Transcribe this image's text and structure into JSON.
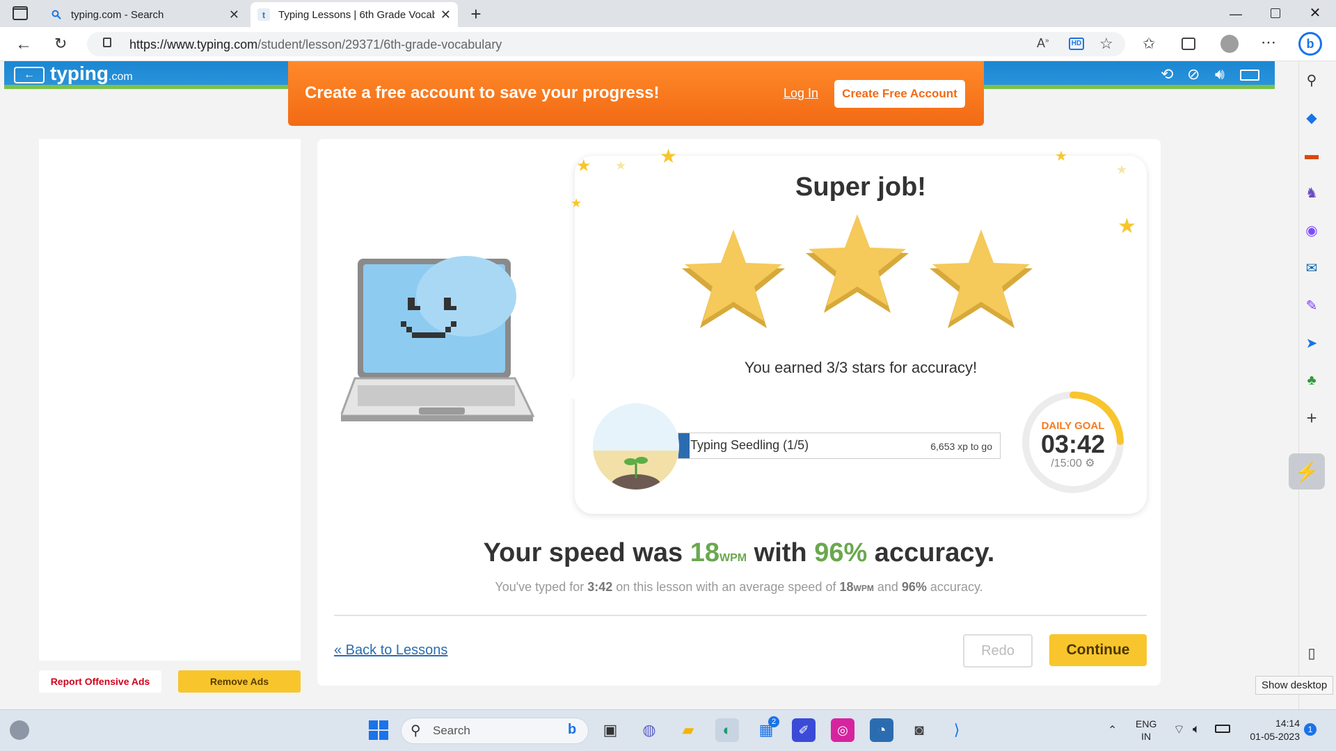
{
  "browser": {
    "tabs": [
      {
        "title": "typing.com - Search",
        "active": false
      },
      {
        "title": "Typing Lessons | 6th Grade Vocab",
        "active": true
      }
    ],
    "url_prefix": "https://www.typing.com",
    "url_path": "/student/lesson/29371/6th-grade-vocabulary"
  },
  "site": {
    "logo_main": "typing",
    "logo_suffix": ".com"
  },
  "promo": {
    "headline": "Create a free account to save your progress!",
    "login_label": "Log In",
    "create_label": "Create Free Account"
  },
  "results": {
    "title": "Super job!",
    "stars_earned": 3,
    "stars_text": "You earned 3/3 stars for accuracy!",
    "level_name": "Typing Seedling (1/5)",
    "xp_to_go": "6,653 xp to go",
    "daily_goal_label": "DAILY GOAL",
    "daily_goal_time": "03:42",
    "daily_goal_total": "/15:00",
    "daily_goal_progress": 0.247,
    "speed_prefix": "Your speed was ",
    "speed_value": "18",
    "speed_unit": "WPM",
    "speed_mid": " with ",
    "accuracy_value": "96%",
    "speed_suffix": " accuracy.",
    "summary_prefix": "You've typed for ",
    "summary_time": "3:42",
    "summary_mid": " on this lesson with an average speed of ",
    "summary_speed": "18",
    "summary_unit": "WPM",
    "summary_and": " and ",
    "summary_accuracy": "96%",
    "summary_suffix": " accuracy.",
    "back_label": "« Back to Lessons",
    "redo_label": "Redo",
    "continue_label": "Continue"
  },
  "ads": {
    "report_label": "Report Offensive Ads",
    "remove_label": "Remove Ads"
  },
  "edge": {
    "tooltip": "Show desktop"
  },
  "taskbar": {
    "search_placeholder": "Search",
    "store_badge": "2",
    "lang_line1": "ENG",
    "lang_line2": "IN",
    "time": "14:14",
    "date": "01-05-2023",
    "notification_count": "1"
  },
  "colors": {
    "accent_orange": "#f47b20",
    "green": "#6aa84f",
    "goal_yellow": "#f8c52c",
    "continue_yellow": "#f8c52c",
    "site_blue": "#1b86d1"
  }
}
